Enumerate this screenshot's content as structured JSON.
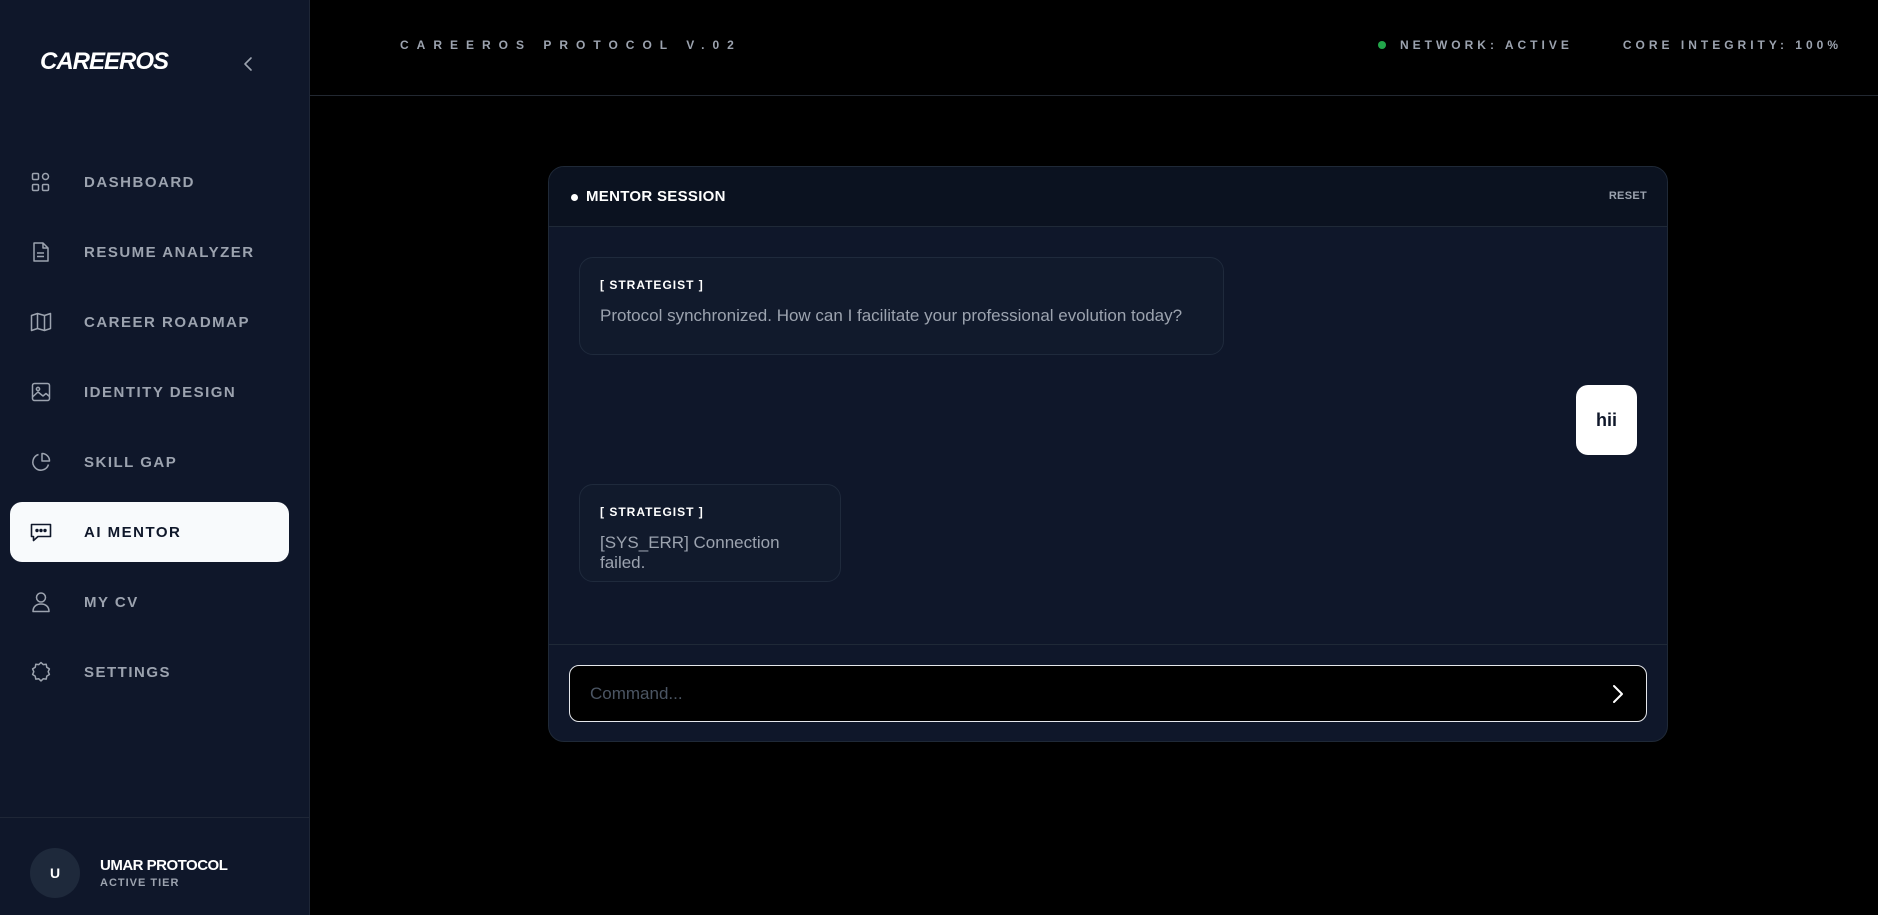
{
  "sidebar": {
    "brand": "CAREEROS",
    "collapse_icon": "chevron-left-icon",
    "items": [
      {
        "label": "DASHBOARD",
        "icon": "grid-icon",
        "active": false
      },
      {
        "label": "RESUME ANALYZER",
        "icon": "document-icon",
        "active": false
      },
      {
        "label": "CAREER ROADMAP",
        "icon": "map-icon",
        "active": false
      },
      {
        "label": "IDENTITY DESIGN",
        "icon": "image-icon",
        "active": false
      },
      {
        "label": "SKILL GAP",
        "icon": "pie-chart-icon",
        "active": false
      },
      {
        "label": "AI MENTOR",
        "icon": "chat-icon",
        "active": true
      },
      {
        "label": "MY CV",
        "icon": "user-icon",
        "active": false
      },
      {
        "label": "SETTINGS",
        "icon": "gear-icon",
        "active": false
      }
    ],
    "user": {
      "initial": "U",
      "name": "UMAR PROTOCOL",
      "tier": "ACTIVE TIER"
    }
  },
  "topbar": {
    "title": "CAREEROS PROTOCOL V.02",
    "network_status": "NETWORK: ACTIVE",
    "core_integrity": "CORE INTEGRITY: 100%"
  },
  "chat": {
    "title": "MENTOR SESSION",
    "reset_label": "RESET",
    "messages": [
      {
        "role": "bot",
        "sender": "[ STRATEGIST ]",
        "text": "Protocol synchronized. How can I facilitate your professional evolution today?"
      },
      {
        "role": "user",
        "text": "hii"
      },
      {
        "role": "bot",
        "sender": "[ STRATEGIST ]",
        "text": "[SYS_ERR] Connection failed."
      }
    ],
    "input": {
      "value": "",
      "placeholder": "Command..."
    },
    "send_icon": "chevron-right-icon"
  },
  "colors": {
    "sidebar_bg": "#0f172a",
    "page_bg": "#000000",
    "active_item_bg": "#f8fafc",
    "status_green": "#22a54a",
    "muted_text": "#9ca3af"
  }
}
